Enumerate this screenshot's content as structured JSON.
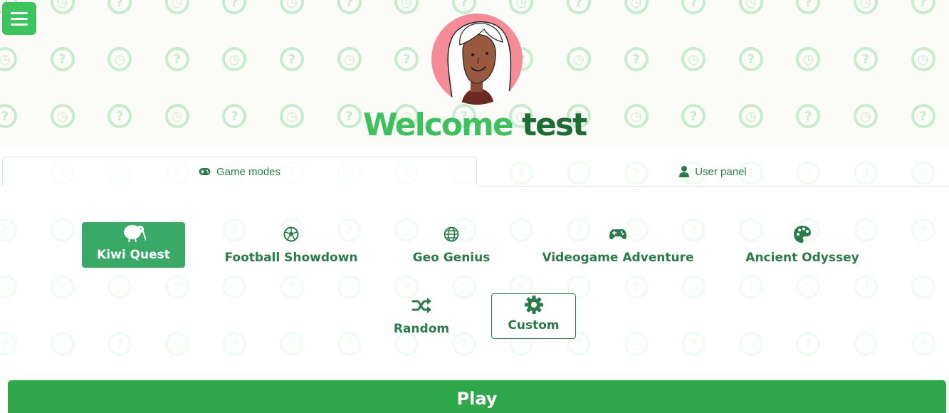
{
  "header": {
    "menu_icon": "hamburger-icon",
    "greeting_word": "Welcome",
    "username": "test",
    "avatar": "avatar-illustration"
  },
  "tabs": [
    {
      "label": "Game modes",
      "icon": "gamepad-icon",
      "active": true
    },
    {
      "label": "User panel",
      "icon": "user-icon",
      "active": false
    }
  ],
  "modes": [
    {
      "label": "Kiwi Quest",
      "icon": "kiwi-icon",
      "selected": true
    },
    {
      "label": "Football Showdown",
      "icon": "football-icon"
    },
    {
      "label": "Geo Genius",
      "icon": "globe-icon"
    },
    {
      "label": "Videogame Adventure",
      "icon": "gamepad-icon"
    },
    {
      "label": "Ancient Odyssey",
      "icon": "palette-icon"
    },
    {
      "label": "Random",
      "icon": "shuffle-icon"
    },
    {
      "label": "Custom",
      "icon": "gear-icon"
    }
  ],
  "play_label": "Play",
  "colors": {
    "brand_green": "#3fc35f",
    "dark_green": "#1f6b35",
    "text_green": "#2b7a4b",
    "selected_bg": "#3aa866",
    "play_bg": "#2ea84a",
    "avatar_bg": "#f48b96"
  }
}
